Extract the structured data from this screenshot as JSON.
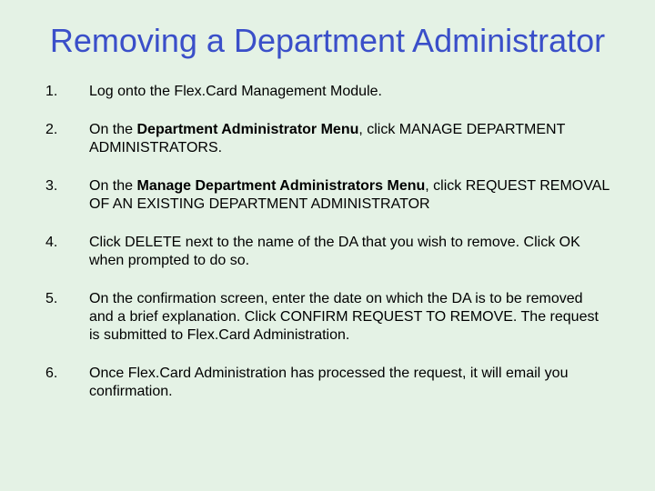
{
  "title": "Removing a Department Administrator",
  "steps": [
    {
      "num": "1.",
      "segments": [
        {
          "text": "Log onto the Flex.Card Management Module.",
          "bold": false
        }
      ]
    },
    {
      "num": "2.",
      "segments": [
        {
          "text": "On the ",
          "bold": false
        },
        {
          "text": "Department Administrator Menu",
          "bold": true
        },
        {
          "text": ", click MANAGE DEPARTMENT ADMINISTRATORS.",
          "bold": false
        }
      ]
    },
    {
      "num": "3.",
      "segments": [
        {
          "text": "On the ",
          "bold": false
        },
        {
          "text": "Manage Department Administrators Menu",
          "bold": true
        },
        {
          "text": ", click REQUEST REMOVAL OF AN EXISTING DEPARTMENT ADMINISTRATOR",
          "bold": false
        }
      ]
    },
    {
      "num": "4.",
      "segments": [
        {
          "text": "Click DELETE next to the name of the DA that you wish to remove.  Click OK when prompted to do so.",
          "bold": false
        }
      ]
    },
    {
      "num": "5.",
      "segments": [
        {
          "text": "On the confirmation screen, enter the date on which the DA is to be removed and a brief explanation.  Click CONFIRM REQUEST TO REMOVE.  The request is submitted to Flex.Card Administration.",
          "bold": false
        }
      ]
    },
    {
      "num": "6.",
      "segments": [
        {
          "text": "Once Flex.Card Administration has processed the request, it will email you confirmation.",
          "bold": false
        }
      ]
    }
  ]
}
